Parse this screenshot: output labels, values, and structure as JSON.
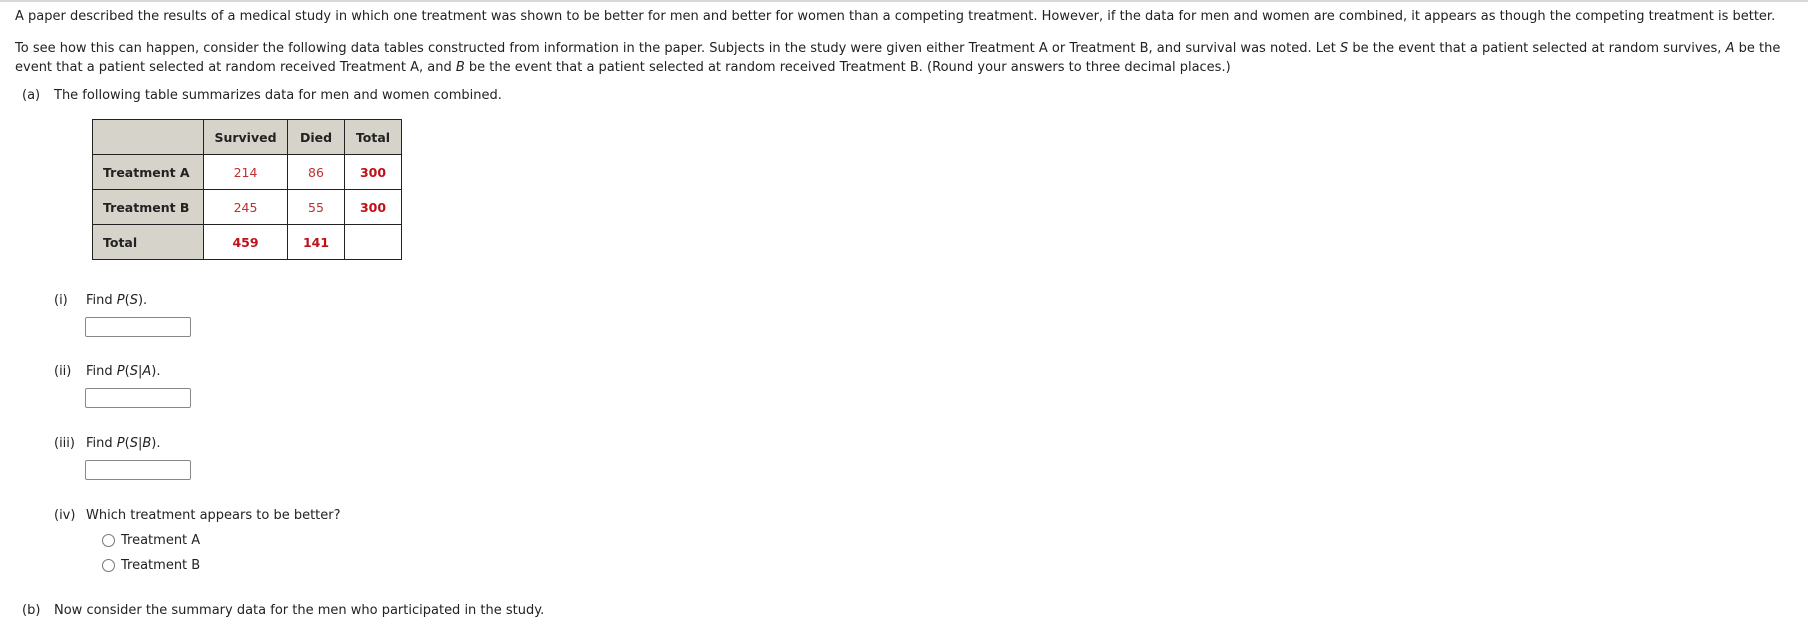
{
  "intro": {
    "p1": "A paper described the results of a medical study in which one treatment was shown to be better for men and better for women than a competing treatment. However, if the data for men and women are combined, it appears as though the competing treatment is better.",
    "p2_a": "To see how this can happen, consider the following data tables constructed from information in the paper. Subjects in the study were given either Treatment A or Treatment B, and survival was noted. Let ",
    "p2_S": "S",
    "p2_b": " be the event that a patient selected at random survives, ",
    "p2_A": "A",
    "p2_c": " be the",
    "p3_a": "event that a patient selected at random received Treatment A, and ",
    "p3_B": "B",
    "p3_b": " be the event that a patient selected at random received Treatment B. (Round your answers to three decimal places.)"
  },
  "part_a": {
    "label": "(a)",
    "text": "The following table summarizes data for men and women combined.",
    "table": {
      "columns": [
        "",
        "Survived",
        "Died",
        "Total"
      ],
      "rows": [
        {
          "label": "Treatment A",
          "survived": "214",
          "died": "86",
          "total": "300"
        },
        {
          "label": "Treatment B",
          "survived": "245",
          "died": "55",
          "total": "300"
        },
        {
          "label": "Total",
          "survived": "459",
          "died": "141",
          "total": ""
        }
      ]
    },
    "questions": [
      {
        "num": "(i)",
        "text_a": "Find ",
        "P": "P",
        "open": "(",
        "S": "S",
        "bar": "",
        "cond": "",
        "close": ").",
        "value": ""
      },
      {
        "num": "(ii)",
        "text_a": "Find ",
        "P": "P",
        "open": "(",
        "S": "S",
        "bar": "|",
        "cond": "A",
        "close": ").",
        "value": ""
      },
      {
        "num": "(iii)",
        "text_a": "Find ",
        "P": "P",
        "open": "(",
        "S": "S",
        "bar": "|",
        "cond": "B",
        "close": ").",
        "value": ""
      }
    ],
    "q4": {
      "num": "(iv)",
      "text": "Which treatment appears to be better?",
      "options": [
        "Treatment A",
        "Treatment B"
      ],
      "selected": null
    }
  },
  "part_b": {
    "label": "(b)",
    "text": "Now consider the summary data for the men who participated in the study."
  },
  "colors": {
    "header_bg": "#d6d3cb",
    "given_value": "#c0302f",
    "computed_value": "#c0111a"
  }
}
